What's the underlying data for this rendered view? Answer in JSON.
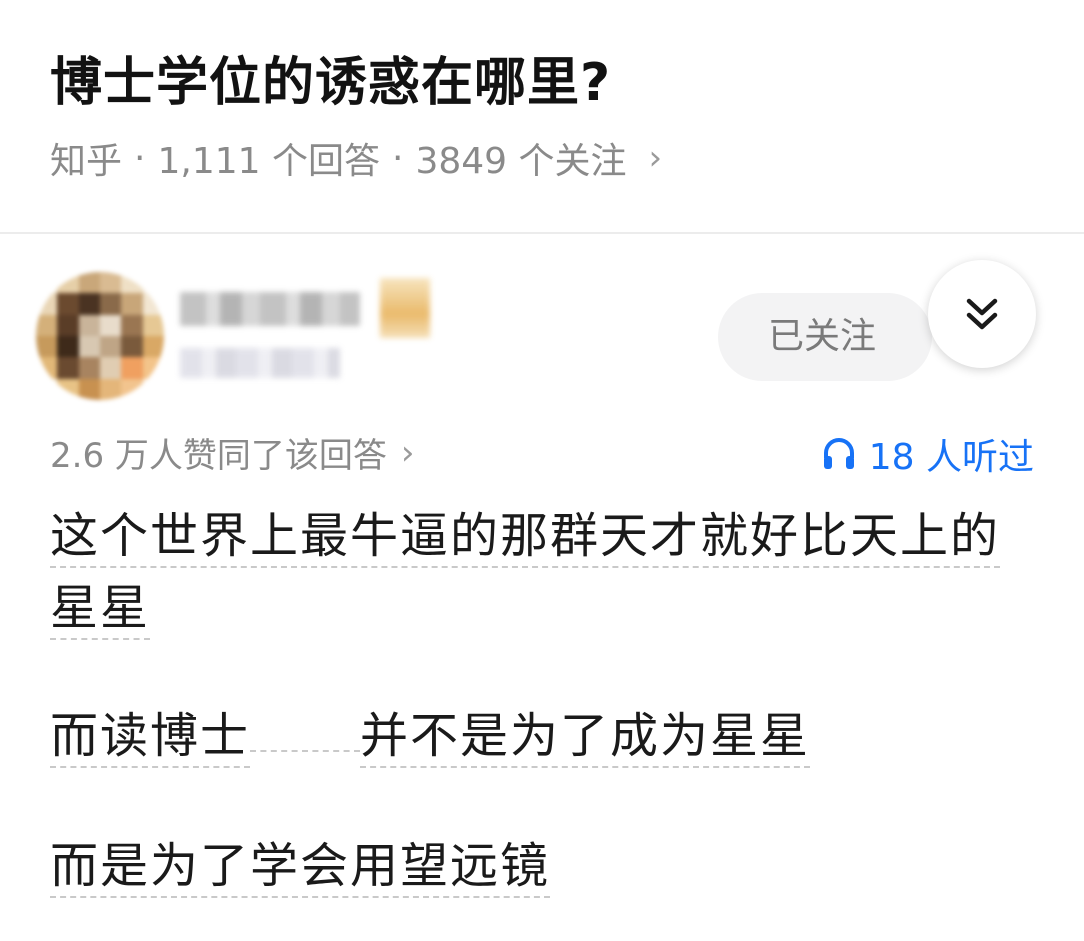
{
  "question": {
    "title": "博士学位的诱惑在哪里?",
    "source": "知乎",
    "separator": "·",
    "answers": "1,111 个回答",
    "followers": "3849 个关注",
    "chevron": "›"
  },
  "author": {
    "follow_label": "已关注",
    "expand_icon": "double-chevron-down-icon"
  },
  "answer": {
    "likes": "2.6 万人赞同了该回答",
    "chevron": "›",
    "listen": "18 人听过",
    "listen_color": "#1772f6",
    "paragraphs": [
      "这个世界上最牛逼的那群天才就好比天上的星星",
      "而读博士",
      "并不是为了成为星星",
      "而是为了学会用望远镜"
    ]
  }
}
